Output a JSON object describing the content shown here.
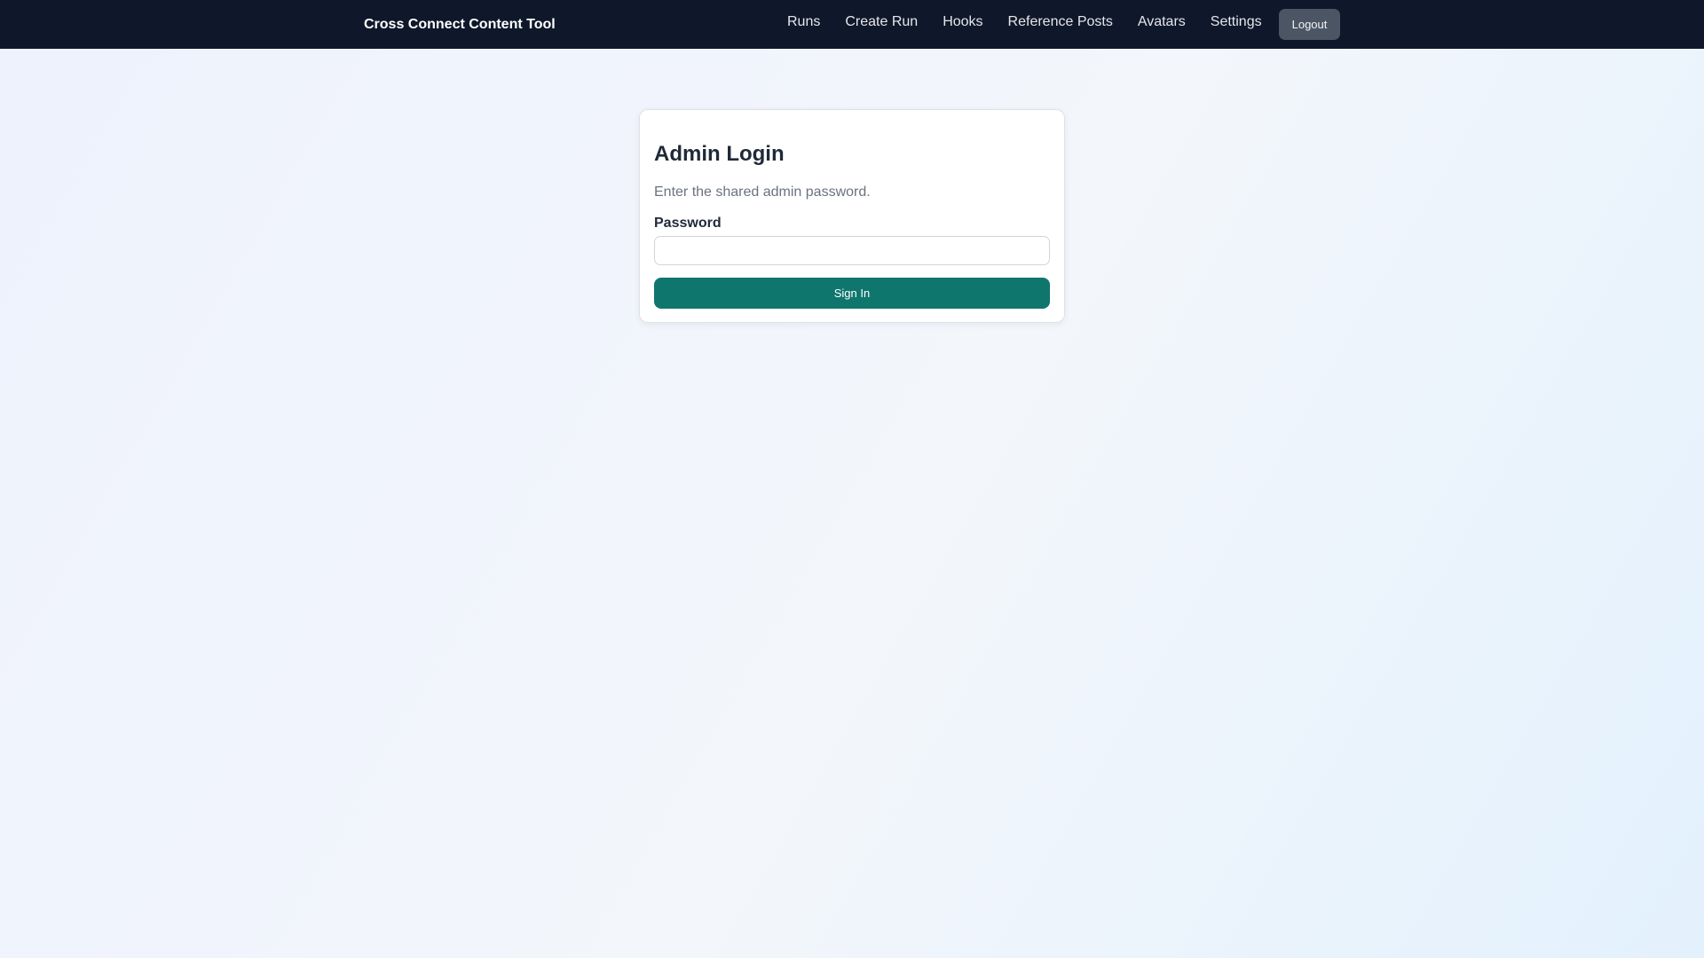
{
  "app": {
    "title": "Cross Connect Content Tool"
  },
  "nav": {
    "links": [
      {
        "label": "Runs"
      },
      {
        "label": "Create Run"
      },
      {
        "label": "Hooks"
      },
      {
        "label": "Reference Posts"
      },
      {
        "label": "Avatars"
      },
      {
        "label": "Settings"
      }
    ],
    "logout_label": "Logout"
  },
  "login": {
    "title": "Admin Login",
    "subtitle": "Enter the shared admin password.",
    "password_label": "Password",
    "password_value": "",
    "submit_label": "Sign In"
  },
  "colors": {
    "navbar_bg": "#0f172a",
    "primary": "#0f766e",
    "logout_bg": "#4b5563"
  }
}
